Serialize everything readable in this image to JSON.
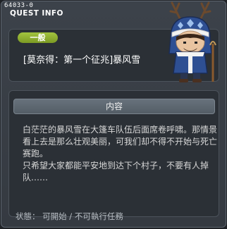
{
  "window": {
    "id": "64033-0",
    "title": "QUEST INFO"
  },
  "quest": {
    "category": "一般",
    "name": "[莫奈得：第一个征兆]暴风雪"
  },
  "content": {
    "header": "内容",
    "paragraphs": [
      "白茫茫的暴风雪在大篷车队伍后面席卷呼啸。那情景看上去是那么壮观美丽，可我们却不得不开始与死亡赛跑。",
      "只希望大家都能平安地到达下个村子，不要有人掉队……"
    ]
  },
  "status": {
    "text": "状態： 可開始 / 不可執行任務"
  },
  "colors": {
    "badge_green": "#8fb032",
    "panel_bg": "#2b3036",
    "window_bg": "#3a4047",
    "header_bar": "#5f6871"
  },
  "icons": {
    "close": "close-icon",
    "portrait": "antlered-hooded-character"
  }
}
